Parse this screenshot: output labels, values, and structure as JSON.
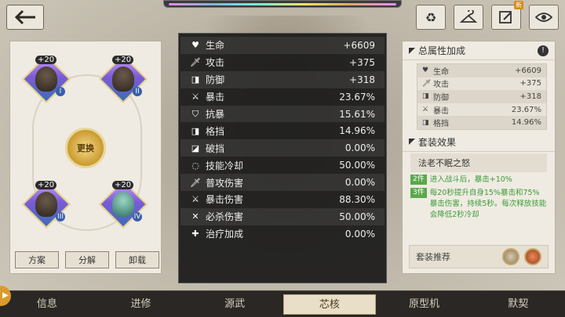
{
  "header": {
    "icons": [
      "back-arrow-icon",
      "recycle-icon",
      "hanger-icon",
      "edit-icon",
      "eye-icon"
    ],
    "new_badge": "新"
  },
  "left_panel": {
    "slots": [
      {
        "plus": "+20",
        "roman": "I"
      },
      {
        "plus": "+20",
        "roman": "II"
      },
      {
        "plus": "+20",
        "roman": "III"
      },
      {
        "plus": "+20",
        "roman": "IV"
      }
    ],
    "center_label": "更换",
    "buttons": [
      "方案",
      "分解",
      "卸载"
    ]
  },
  "stats": [
    {
      "icon": "heart-icon",
      "glyph": "♥",
      "name": "生命",
      "value": "+6609"
    },
    {
      "icon": "sword-icon",
      "glyph": "🗡",
      "name": "攻击",
      "value": "+375"
    },
    {
      "icon": "shield-icon",
      "glyph": "◨",
      "name": "防御",
      "value": "+318"
    },
    {
      "icon": "crossed-swords-icon",
      "glyph": "⚔",
      "name": "暴击",
      "value": "23.67%"
    },
    {
      "icon": "resist-icon",
      "glyph": "⛉",
      "name": "抗暴",
      "value": "15.61%"
    },
    {
      "icon": "block-icon",
      "glyph": "◨",
      "name": "格挡",
      "value": "14.96%"
    },
    {
      "icon": "break-block-icon",
      "glyph": "◪",
      "name": "破挡",
      "value": "0.00%"
    },
    {
      "icon": "cooldown-icon",
      "glyph": "◌",
      "name": "技能冷却",
      "value": "50.00%"
    },
    {
      "icon": "normal-attack-icon",
      "glyph": "🗡",
      "name": "普攻伤害",
      "value": "0.00%"
    },
    {
      "icon": "crit-damage-icon",
      "glyph": "⚔",
      "name": "暴击伤害",
      "value": "88.30%"
    },
    {
      "icon": "ultimate-icon",
      "glyph": "✕",
      "name": "必杀伤害",
      "value": "50.00%"
    },
    {
      "icon": "heal-icon",
      "glyph": "✚",
      "name": "治疗加成",
      "value": "0.00%"
    }
  ],
  "right_panel": {
    "total_title": "总属性加成",
    "total_attrs": [
      {
        "glyph": "♥",
        "name": "生命",
        "value": "+6609"
      },
      {
        "glyph": "🗡",
        "name": "攻击",
        "value": "+375"
      },
      {
        "glyph": "◨",
        "name": "防御",
        "value": "+318"
      },
      {
        "glyph": "⚔",
        "name": "暴击",
        "value": "23.67%"
      },
      {
        "glyph": "◨",
        "name": "格挡",
        "value": "14.96%"
      }
    ],
    "set_title": "套装效果",
    "set_name": "法老不眠之怒",
    "set_effects": [
      {
        "tag": "2件",
        "text": "进入战斗后，暴击+10%"
      },
      {
        "tag": "3件",
        "text": "每20秒提升自身15%暴击和75%暴击伤害，持续5秒。每次释放技能会降低2秒冷却"
      }
    ],
    "recommend_label": "套装推荐"
  },
  "bottom_nav": [
    "信息",
    "进修",
    "源武",
    "芯核",
    "原型机",
    "默契"
  ],
  "colors": {
    "accent_green": "#3c9b3a",
    "active_tab": "#e9dfc8",
    "panel_dark": "#1a1a1a"
  }
}
